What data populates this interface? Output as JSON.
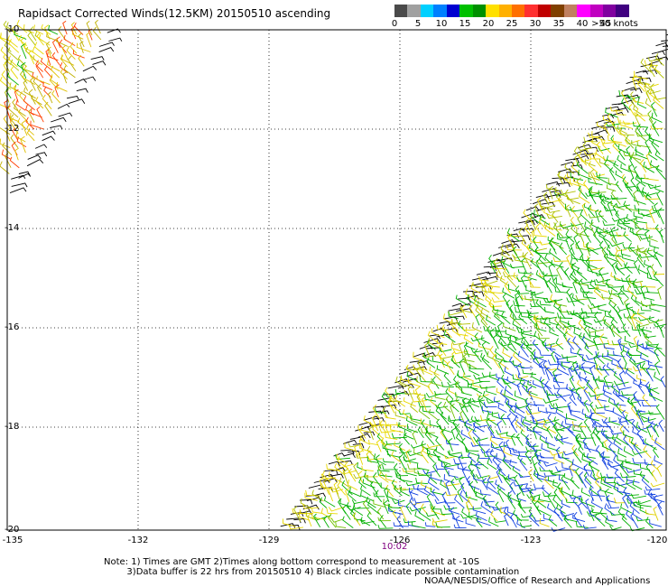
{
  "title": "Rapidsact Corrected Winds(12.5KM) 20150510 ascending",
  "colorbar": {
    "colors": [
      "#4a4a4a",
      "#a0a0a0",
      "#00d0ff",
      "#0080ff",
      "#0000d0",
      "#00c000",
      "#009000",
      "#ffe000",
      "#ffb000",
      "#ff7000",
      "#ff3030",
      "#c00000",
      "#804000",
      "#c08060",
      "#ff00ff",
      "#c000c0",
      "#8000a0",
      "#400080"
    ],
    "labels": [
      "0",
      "5",
      "10",
      "15",
      "20",
      "25",
      "30",
      "35",
      "40",
      "45",
      ">50 knots"
    ]
  },
  "lat_ticks": [
    "-10",
    "-12",
    "-14",
    "-16",
    "-18",
    "-20"
  ],
  "lon_ticks": [
    "-135",
    "-132",
    "-129",
    "-126",
    "-123",
    "-120"
  ],
  "time_label": "10:02",
  "notes": "Note: 1) Times are GMT 2)Times along bottom correspond to measurement at -10S\n        3)Data buffer is 22 hrs from 20150510 4) Black circles indicate possible contamination",
  "credit": "NOAA/NESDIS/Office of Research and Applications"
}
